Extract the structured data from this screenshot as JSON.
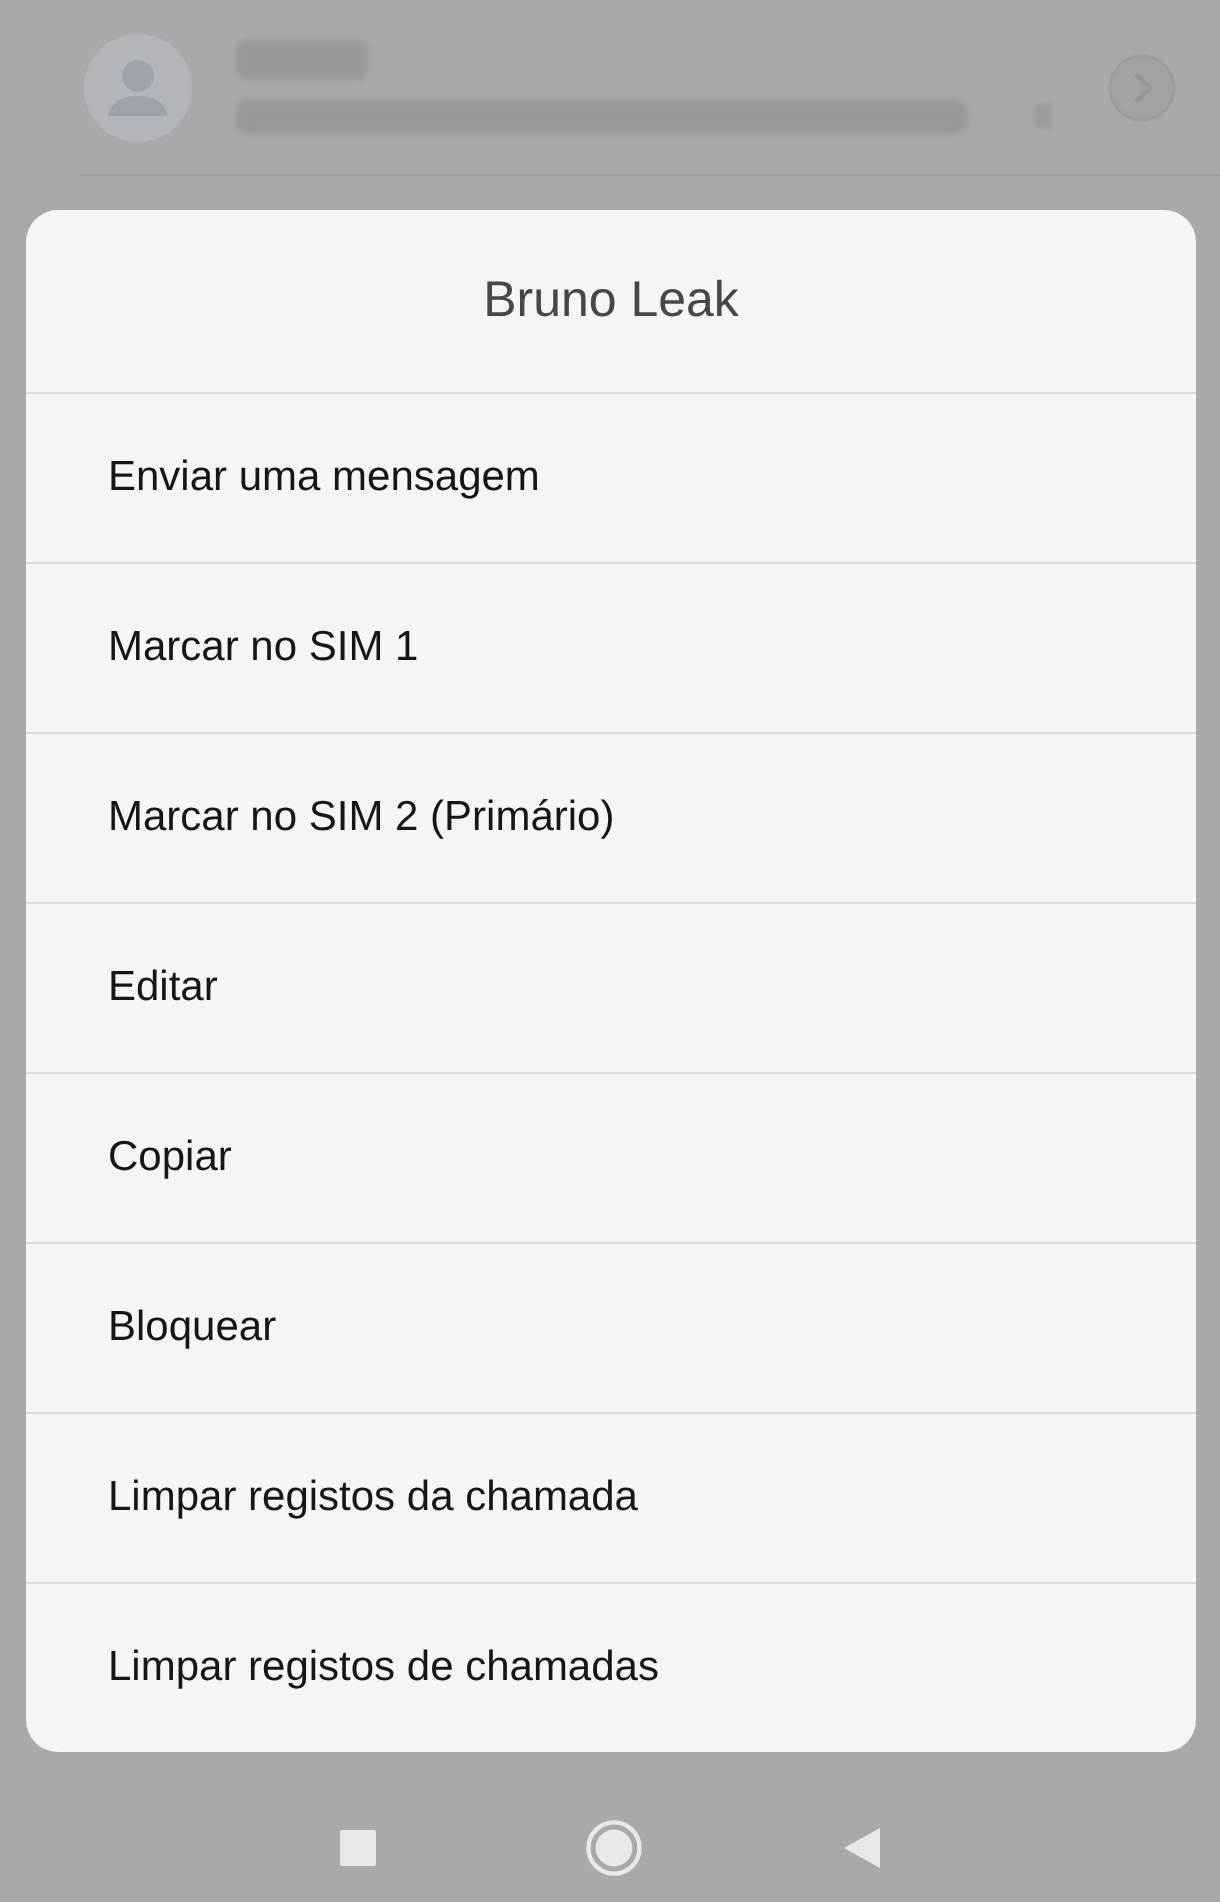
{
  "dialog": {
    "title": "Bruno Leak",
    "items": [
      "Enviar uma mensagem",
      "Marcar no SIM 1",
      "Marcar no SIM 2 (Primário)",
      "Editar",
      "Copiar",
      "Bloquear",
      "Limpar registos da chamada",
      "Limpar registos de chamadas"
    ]
  }
}
